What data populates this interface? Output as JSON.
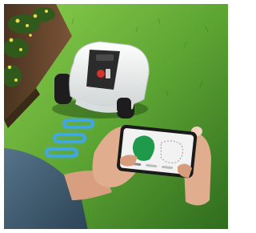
{
  "scene": {
    "subject": "robotic-lawn-mower-controlled-by-smartphone",
    "colors": {
      "frame": "#ffffff",
      "grass_light": "#6fb43a",
      "grass_dark": "#2f6b1e",
      "mower_body": "#e9ecec",
      "mower_panel": "#2b2b2b",
      "mower_button": "#d9322a",
      "wheel": "#1d1d1d",
      "signal_glow": "#3aa7ff",
      "wall": "#6e4b2e",
      "flowers": "#e9d84a",
      "phone_screen": "#f2f2f2",
      "map_area": "#1f9a4b",
      "sleeve": "#3f5f77",
      "skin": "#e0ae8e"
    },
    "icons": [
      "mower",
      "smartphone",
      "signal-waves",
      "map-area"
    ]
  }
}
